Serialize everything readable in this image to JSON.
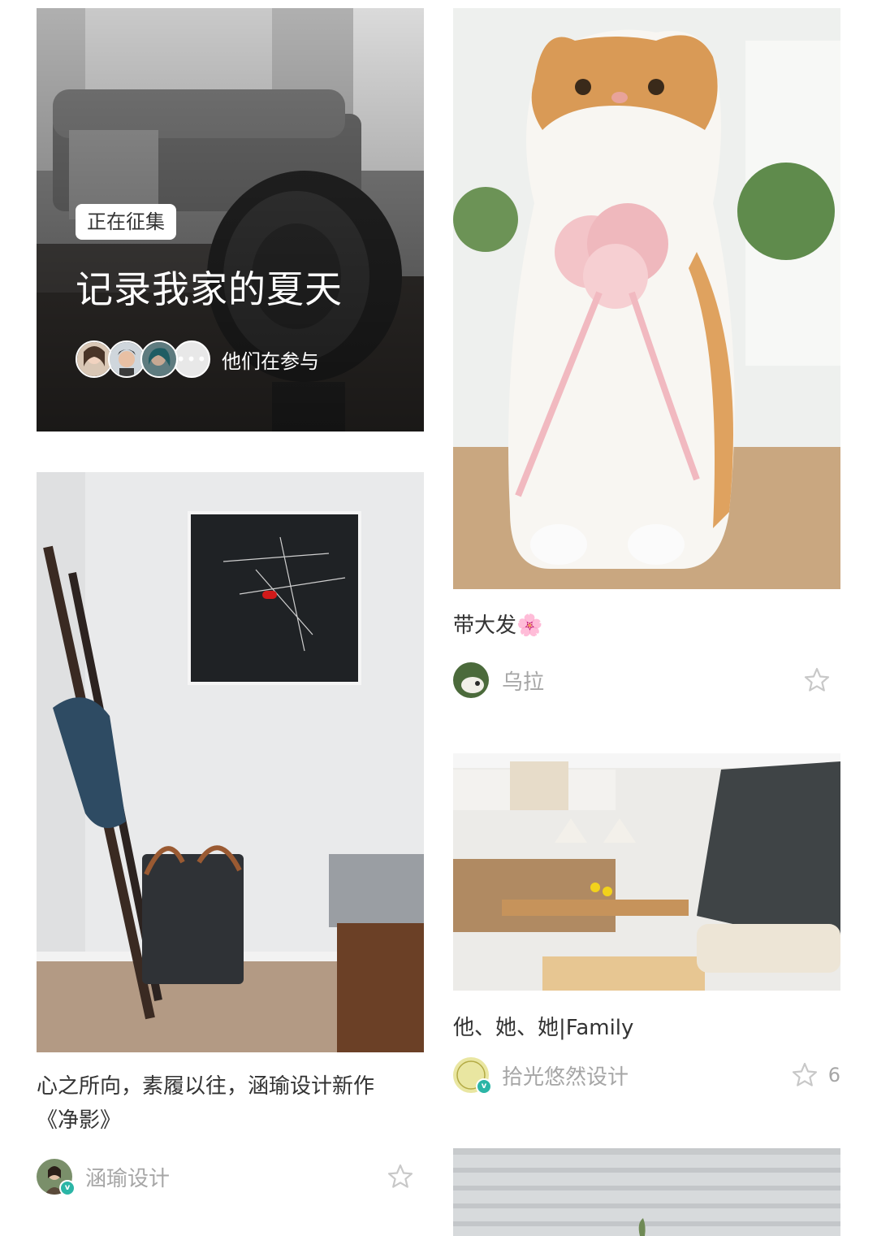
{
  "promo": {
    "badge": "正在征集",
    "title": "记录我家的夏天",
    "participants_label": "他们在参与",
    "more_glyph": "•••"
  },
  "cards": [
    {
      "title": "心之所向，素履以往，涵瑜设计新作\n《净影》",
      "author": "涵瑜设计",
      "verified": true,
      "favorites": "",
      "icon": "star-outline-icon"
    },
    {
      "title": "带大发🌸",
      "author": "乌拉",
      "verified": false,
      "favorites": "",
      "icon": "star-outline-icon"
    },
    {
      "title": "他、她、她|Family",
      "author": "拾光悠然设计",
      "verified": true,
      "favorites": "6",
      "icon": "star-outline-icon"
    }
  ],
  "verified_glyph": "v",
  "colors": {
    "text_primary": "#333333",
    "text_secondary": "#a6a6a6",
    "verified": "#2bb5a6",
    "icon": "#c8c8c8"
  }
}
